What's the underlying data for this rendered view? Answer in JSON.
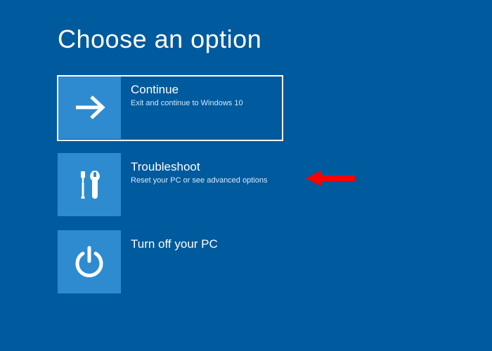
{
  "title": "Choose an option",
  "options": [
    {
      "title": "Continue",
      "subtitle": "Exit and continue to Windows 10"
    },
    {
      "title": "Troubleshoot",
      "subtitle": "Reset your PC or see advanced options"
    },
    {
      "title": "Turn off your PC",
      "subtitle": ""
    }
  ],
  "colors": {
    "background": "#005a9e",
    "tile": "#2e8bd0",
    "annotation_arrow": "#ff0000"
  }
}
